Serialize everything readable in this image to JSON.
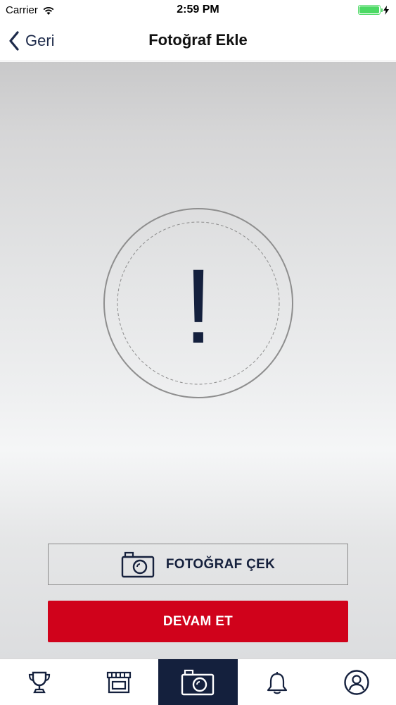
{
  "status_bar": {
    "carrier": "Carrier",
    "time": "2:59 PM",
    "battery_level": 1.0,
    "battery_color": "#4cd964"
  },
  "nav": {
    "back_label": "Geri",
    "title": "Fotoğraf Ekle"
  },
  "placeholder": {
    "symbol": "!",
    "icon": "exclamation-icon"
  },
  "actions": {
    "photo_button_label": "FOTOĞRAF ÇEK",
    "photo_button_icon": "camera-icon",
    "continue_button_label": "DEVAM ET",
    "continue_color": "#d0021b"
  },
  "tab_bar": {
    "active_index": 2,
    "active_color": "#14203d",
    "tabs": [
      {
        "icon": "trophy-icon"
      },
      {
        "icon": "store-icon"
      },
      {
        "icon": "camera-icon"
      },
      {
        "icon": "bell-icon"
      },
      {
        "icon": "profile-icon"
      }
    ]
  }
}
